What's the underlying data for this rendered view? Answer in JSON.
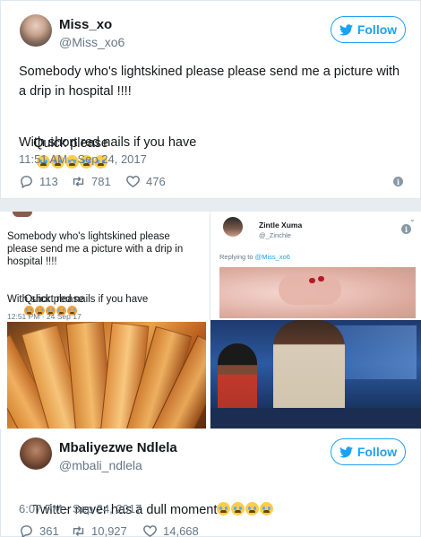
{
  "tweet1": {
    "display_name": "Miss_xo",
    "handle": "@Miss_xo6",
    "follow_label": "Follow",
    "text_line1": "Somebody who's lightskined please please send me a picture with",
    "text_line2": "a drip in hospital !!!!",
    "text_line3": "Quick please",
    "text_line4": "With short red nails if you have",
    "timestamp": "11:51 AM - Sep 24, 2017",
    "replies": "113",
    "retweets": "781",
    "likes": "476"
  },
  "screenshot_left": {
    "text_line1": "Somebody who's lightskined please",
    "text_line2": "please send me a picture with a drip in",
    "text_line3": "hospital !!!!",
    "text_line4": "Quick please",
    "text_line5": "With short red nails if you have",
    "timestamp": "12:51 PM · 24 Sep 17"
  },
  "screenshot_right": {
    "display_name": "Zintle Xuma",
    "handle": "@_Zinchle",
    "replying_prefix": "Replying to",
    "replying_handle": "@Miss_xo6"
  },
  "tweet2": {
    "display_name": "Mbaliyezwe Ndlela",
    "handle": "@mbali_ndlela",
    "follow_label": "Follow",
    "text": "Twitter never has a dull moment",
    "timestamp": "6:07 PM - Sep 24, 2017",
    "replies": "361",
    "retweets": "10,927",
    "likes": "14,668"
  },
  "colors": {
    "twitter_blue": "#1da1f2",
    "muted_text": "#657786",
    "border": "#e1e8ed"
  },
  "icons": [
    "twitter-bird-icon",
    "reply-icon",
    "retweet-icon",
    "heart-icon",
    "info-icon",
    "crying-face-emoji",
    "chevron-down-icon"
  ]
}
